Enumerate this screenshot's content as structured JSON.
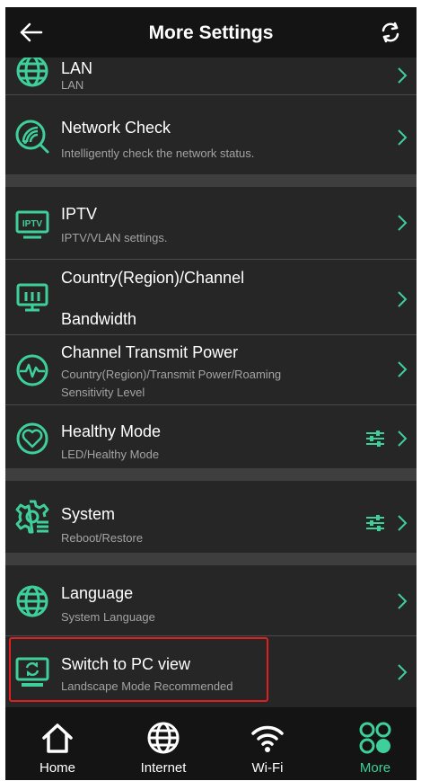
{
  "header": {
    "title": "More Settings",
    "back_icon": "arrow-left-icon",
    "refresh_icon": "refresh-icon"
  },
  "items": [
    {
      "title": "LAN",
      "subtitle": "LAN",
      "icon": "globe-icon"
    },
    {
      "title": "Network Check",
      "subtitle": "Intelligently check the network status.",
      "icon": "network-check-icon"
    },
    {
      "title": "IPTV",
      "subtitle": "IPTV/VLAN settings.",
      "icon": "iptv-icon"
    },
    {
      "title": "Country(Region)/Channel",
      "title_line2": "Bandwidth",
      "icon": "monitor-bars-icon"
    },
    {
      "title": "Channel Transmit Power",
      "subtitle": "Country(Region)/Transmit Power/Roaming",
      "subtitle_line2": "Sensitivity Level",
      "icon": "pulse-icon"
    },
    {
      "title": "Healthy Mode",
      "subtitle": "LED/Healthy Mode",
      "icon": "heart-icon"
    },
    {
      "title": "System",
      "subtitle": "Reboot/Restore",
      "icon": "gear-icon"
    },
    {
      "title": "Language",
      "subtitle": "System Language",
      "icon": "globe-icon"
    },
    {
      "title": "Switch to PC view",
      "subtitle": "Landscape Mode Recommended",
      "icon": "pc-view-icon"
    }
  ],
  "tabs": [
    {
      "label": "Home",
      "icon": "home-icon",
      "active": false
    },
    {
      "label": "Internet",
      "icon": "globe-icon",
      "active": false
    },
    {
      "label": "Wi-Fi",
      "icon": "wifi-icon",
      "active": false
    },
    {
      "label": "More",
      "icon": "more-grid-icon",
      "active": true
    }
  ],
  "colors": {
    "accent": "#3ecf9a",
    "background": "#262626",
    "header": "#141414",
    "highlight_border": "#e02020",
    "subtitle": "#a3a3a3"
  }
}
